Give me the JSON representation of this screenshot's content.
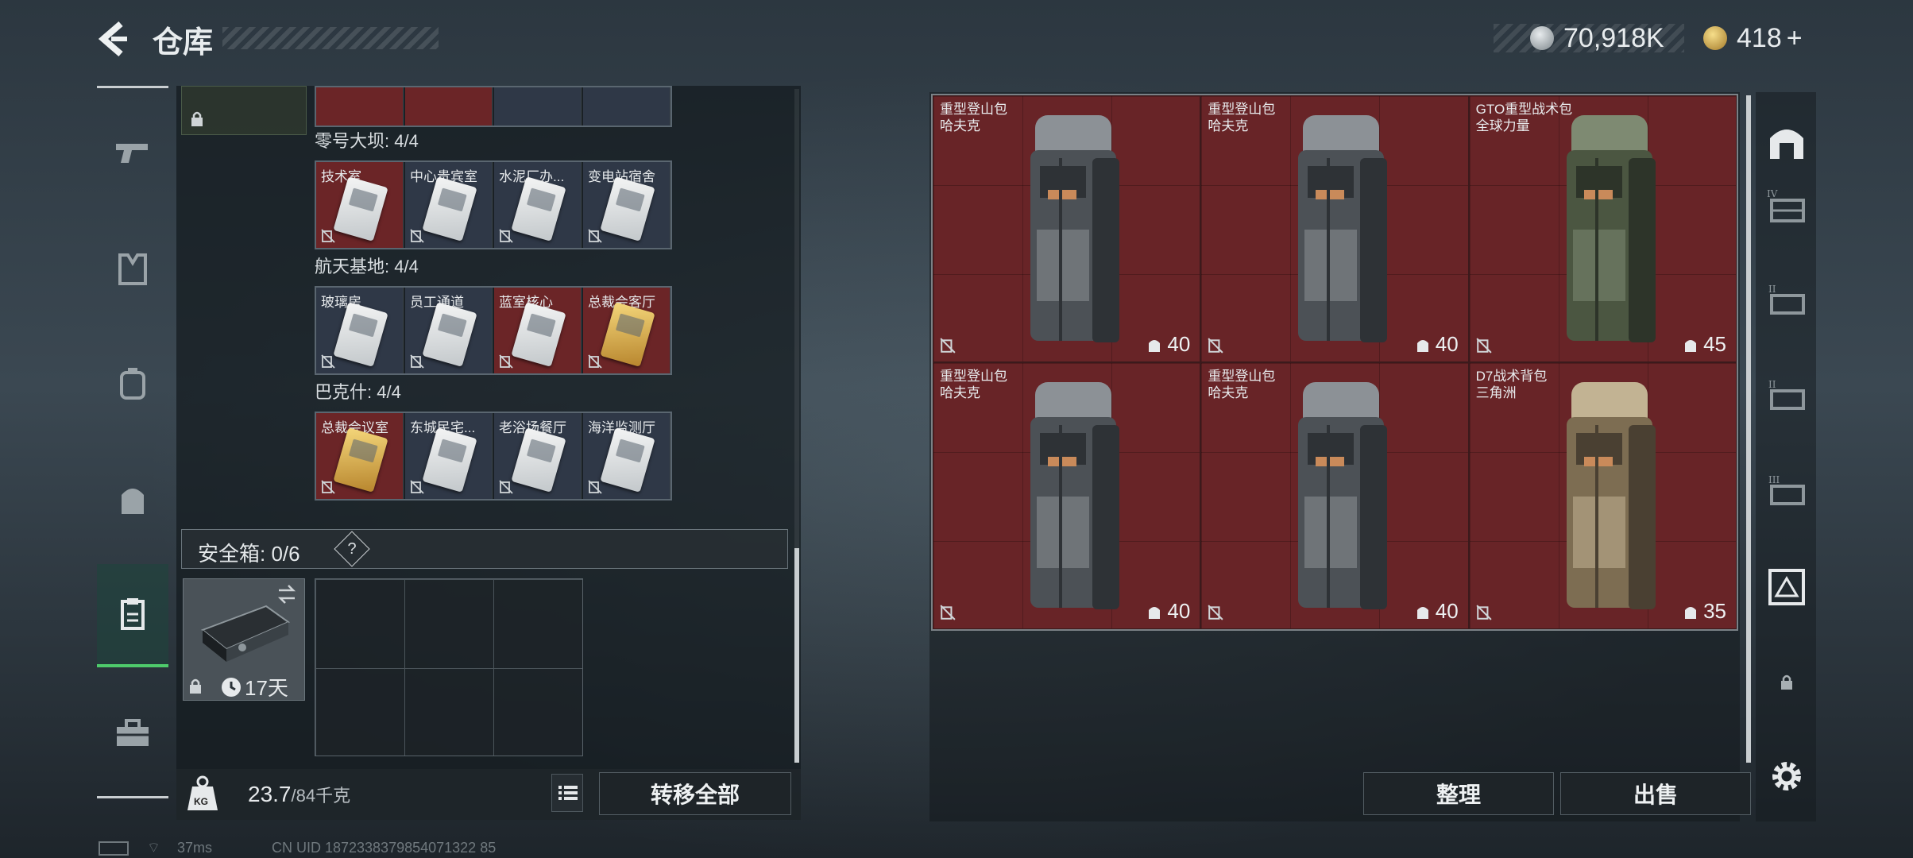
{
  "header": {
    "title": "仓库",
    "coins": "70,918K",
    "gems": "418",
    "gems_add": "+"
  },
  "left_groups": [
    {
      "label": "零号大坝: 4/4",
      "keys": [
        "技术室",
        "中心贵宾室",
        "水泥厂办...",
        "变电站宿舍"
      ],
      "styles": [
        "red",
        "blue",
        "blue",
        "blue"
      ]
    },
    {
      "label": "航天基地: 4/4",
      "keys": [
        "玻璃房",
        "员工通道",
        "蓝室核心",
        "总裁会客厅"
      ],
      "styles": [
        "blue",
        "blue",
        "red",
        "gold"
      ]
    },
    {
      "label": "巴克什: 4/4",
      "keys": [
        "总裁会议室",
        "东城民宅...",
        "老浴场餐厅",
        "海洋监测厅"
      ],
      "styles": [
        "gold",
        "blue",
        "blue",
        "blue"
      ]
    }
  ],
  "safebox": {
    "label": "安全箱: 0/6",
    "help": "?",
    "time": "17天"
  },
  "weight": {
    "current": "23.7",
    "max": "/84千克",
    "icon_label": "KG"
  },
  "buttons": {
    "transfer_all": "转移全部",
    "organize": "整理",
    "sell": "出售"
  },
  "bags": [
    {
      "name1": "重型登山包",
      "name2": "哈夫克",
      "cap": "40",
      "color": "grey"
    },
    {
      "name1": "重型登山包",
      "name2": "哈夫克",
      "cap": "40",
      "color": "grey"
    },
    {
      "name1": "GTO重型战术包",
      "name2": "全球力量",
      "cap": "45",
      "color": "green"
    },
    {
      "name1": "重型登山包",
      "name2": "哈夫克",
      "cap": "40",
      "color": "grey"
    },
    {
      "name1": "重型登山包",
      "name2": "哈夫克",
      "cap": "40",
      "color": "grey"
    },
    {
      "name1": "D7战术背包",
      "name2": "三角洲",
      "cap": "35",
      "color": "tan"
    }
  ],
  "status": {
    "ping": "37ms",
    "uid": "CN UID 1872338379854071322 85"
  }
}
